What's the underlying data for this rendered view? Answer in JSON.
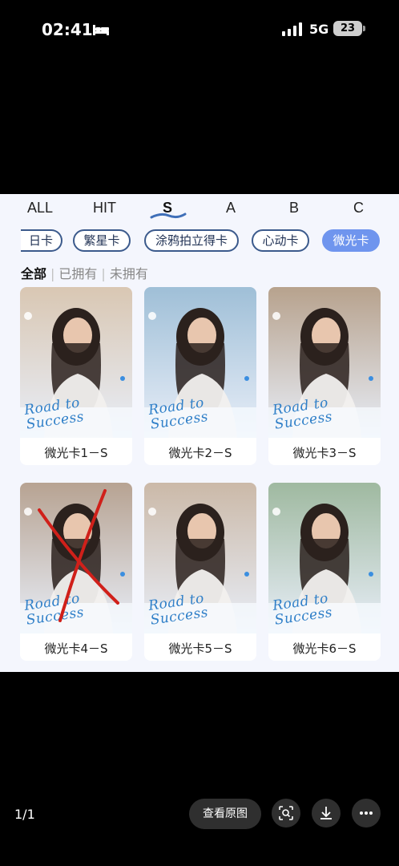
{
  "status_bar": {
    "time": "02:41",
    "network": "5G",
    "battery": "23"
  },
  "tabs": [
    "ALL",
    "HIT",
    "S",
    "A",
    "B",
    "C"
  ],
  "active_tab": "S",
  "chips": [
    "生日卡",
    "繁星卡",
    "涂鸦拍立得卡",
    "心动卡",
    "微光卡"
  ],
  "chip_first_visible": "日卡",
  "active_chip": "微光卡",
  "filters": {
    "all": "全部",
    "owned": "已拥有",
    "not_owned": "未拥有"
  },
  "cards": [
    {
      "label": "微光卡1－S",
      "bg": "#d9c7b3"
    },
    {
      "label": "微光卡2－S",
      "bg": "#9fbfd7"
    },
    {
      "label": "微光卡3－S",
      "bg": "#b7a28d"
    },
    {
      "label": "微光卡4－S",
      "bg": "#b7a392"
    },
    {
      "label": "微光卡5－S",
      "bg": "#cbb9a8"
    },
    {
      "label": "微光卡6－S",
      "bg": "#9fb9a0"
    }
  ],
  "card_overlay_text": "Road to Success",
  "bottom_bar": {
    "counter": "1/1",
    "view_original": "查看原图"
  },
  "colors": {
    "accent": "#6f95ee",
    "chip_border": "#3b5a8c",
    "cross_out": "#d0201a"
  },
  "icons": [
    "bed-icon",
    "signal-icon",
    "lens-search-icon",
    "download-icon",
    "more-icon"
  ]
}
